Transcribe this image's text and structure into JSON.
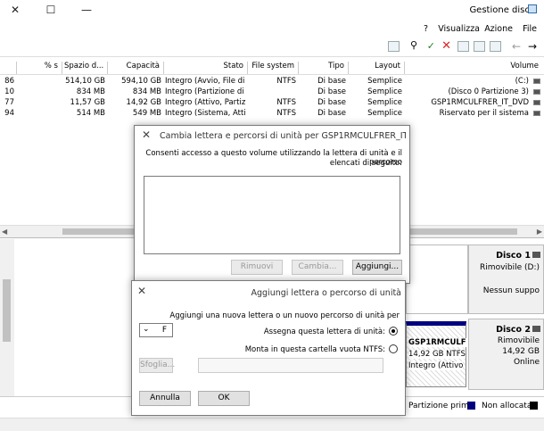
{
  "window": {
    "title": "Gestione disco",
    "controls": {
      "minimize": "—",
      "maximize": "☐",
      "close": "✕"
    }
  },
  "menu": [
    "File",
    "Azione",
    "Visualizza",
    "?"
  ],
  "toolbar_icons": [
    "back-icon",
    "forward-icon",
    "properties-icon",
    "help-icon",
    "console-icon",
    "delete-icon",
    "check-icon",
    "search-icon",
    "grid-icon"
  ],
  "table": {
    "headers": [
      "Volume",
      "Layout",
      "Tipo",
      "File system",
      "Stato",
      "Capacità",
      "Spazio d...",
      "% s"
    ],
    "rows": [
      [
        "(C:)",
        "Semplice",
        "Di base",
        "NTFS",
        "Integro (Avvio, File di ...",
        "594,10 GB",
        "514,10 GB",
        "86"
      ],
      [
        "(Disco 0 Partizione 3)",
        "Semplice",
        "Di base",
        "",
        "Integro (Partizione di ri...",
        "834 MB",
        "834 MB",
        "10"
      ],
      [
        "GSP1RMCULFRER_IT_DVD",
        "Semplice",
        "Di base",
        "NTFS",
        "Integro (Attivo, Partizi...",
        "14,92 GB",
        "11,57 GB",
        "77"
      ],
      [
        "Riservato per il sistema",
        "Semplice",
        "Di base",
        "NTFS",
        "Integro (Sistema, Attiv...",
        "549 MB",
        "514 MB",
        "94"
      ]
    ]
  },
  "disks": {
    "disk1": {
      "title": "Disco 1",
      "type": "Rimovibile (D:)",
      "status": "Nessun suppo"
    },
    "disk2": {
      "title": "Disco 2",
      "type": "Rimovibile",
      "size": "14,92 GB",
      "status": "Online"
    },
    "partition": {
      "name": "GSP1RMCULF",
      "size": "14,92 GB NTFS",
      "status": "Integro (Attivo"
    }
  },
  "legend": {
    "unallocated": "Non allocata",
    "primary": "Partizione prim",
    "primary_color": "#00007f",
    "unallocated_color": "#000000"
  },
  "dialog1": {
    "title": "Cambia lettera e percorsi di unità per GSP1RMCULFRER_IT_DVD",
    "description_line1": "Consenti accesso a questo volume utilizzando la lettera di unità e il percorso",
    "description_line2": "elencati di seguito:",
    "buttons": {
      "add": "Aggiungi...",
      "change": "Cambia...",
      "remove": "Rimuovi"
    }
  },
  "dialog2": {
    "title": "Aggiungi lettera o percorso di unità",
    "description": "Aggiungi una nuova lettera o un nuovo percorso di unità per",
    "option1": "Assegna questa lettera di unità:",
    "drive_letter": "F",
    "option2": "Monta in questa cartella vuota NTFS:",
    "browse": "Sfoglia...",
    "ok": "OK",
    "cancel": "Annulla"
  }
}
